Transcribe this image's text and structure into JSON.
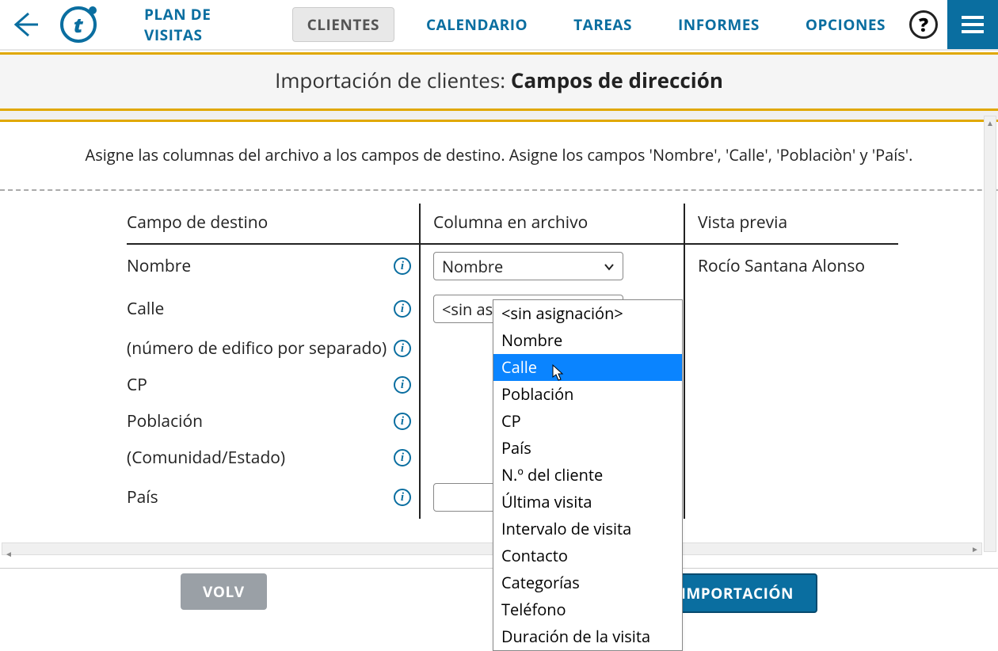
{
  "nav": {
    "tabs": [
      "PLAN DE VISITAS",
      "CLIENTES",
      "CALENDARIO",
      "TAREAS",
      "INFORMES",
      "OPCIONES"
    ],
    "active_index": 1,
    "logo_letter": "t",
    "help_glyph": "?"
  },
  "title": {
    "prefix": "Importación de clientes: ",
    "bold": "Campos de dirección"
  },
  "instruction": "Asigne las columnas del archivo a los campos de destino. Asigne los campos 'Nombre', 'Calle', 'Poblaciòn' y 'País'.",
  "headers": {
    "dest": "Campo de destino",
    "file": "Columna en archivo",
    "prev": "Vista previa"
  },
  "rows": [
    {
      "dest": "Nombre",
      "file_select": "Nombre",
      "preview": "Rocío Santana Alonso",
      "wide": false
    },
    {
      "dest": "Calle",
      "file_select": "<sin asignación>",
      "preview": "",
      "wide": false
    },
    {
      "dest": "(número de edifico por separado)",
      "file_select": "",
      "preview": "",
      "wide": false
    },
    {
      "dest": "CP",
      "file_select": "",
      "preview": "",
      "wide": false
    },
    {
      "dest": "Población",
      "file_select": "",
      "preview": "",
      "wide": false
    },
    {
      "dest": "(Comunidad/Estado)",
      "file_select": "",
      "preview": "",
      "wide": false
    },
    {
      "dest": "País",
      "file_select": "",
      "preview": "",
      "wide": true
    }
  ],
  "dropdown_options": [
    "<sin asignación>",
    "Nombre",
    "Calle",
    "Población",
    "CP",
    "País",
    "N.º del cliente",
    "Última visita",
    "Intervalo de visita",
    "Contacto",
    "Categorías",
    "Teléfono",
    "Duración de la visita"
  ],
  "dropdown_highlight_index": 2,
  "buttons": {
    "back": "VOLV",
    "next": "VISTA PREVIA E IMPORTACIÓN"
  },
  "info_glyph": "i"
}
